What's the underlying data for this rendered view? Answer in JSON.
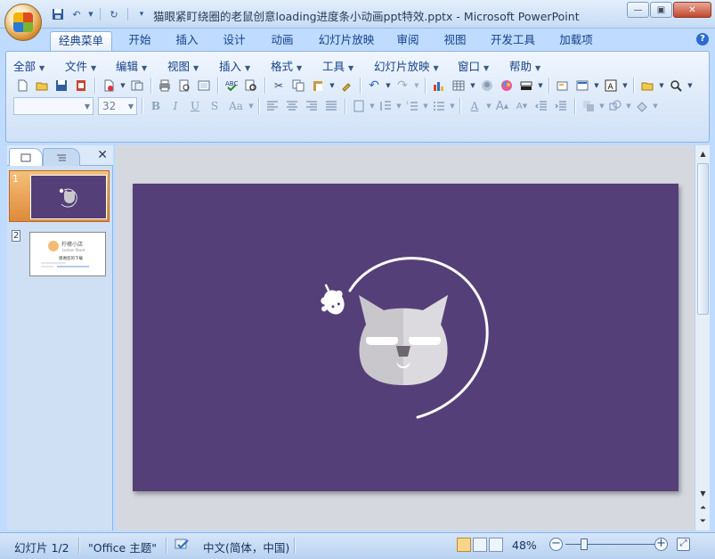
{
  "window": {
    "title": "猫眼紧盯绕圈的老鼠创意loading进度条小动画ppt特效.pptx - Microsoft PowerPoint",
    "controls": [
      "minimize",
      "maximize",
      "close"
    ]
  },
  "ribbon_tabs": [
    {
      "label": "经典菜单",
      "active": true
    },
    {
      "label": "开始"
    },
    {
      "label": "插入"
    },
    {
      "label": "设计"
    },
    {
      "label": "动画"
    },
    {
      "label": "幻灯片放映"
    },
    {
      "label": "审阅"
    },
    {
      "label": "视图"
    },
    {
      "label": "开发工具"
    },
    {
      "label": "加载项"
    }
  ],
  "menu_bar": [
    {
      "label": "全部"
    },
    {
      "label": "文件"
    },
    {
      "label": "编辑"
    },
    {
      "label": "视图"
    },
    {
      "label": "插入"
    },
    {
      "label": "格式"
    },
    {
      "label": "工具"
    },
    {
      "label": "幻灯片放映"
    },
    {
      "label": "窗口"
    },
    {
      "label": "帮助"
    }
  ],
  "font_box": {
    "font_name": "",
    "font_size": "32"
  },
  "format_buttons": {
    "bold": "B",
    "italic": "I",
    "underline": "U",
    "shadow": "S",
    "case": "Aa",
    "font_color": "A"
  },
  "slides": [
    {
      "number": "1",
      "selected": true
    },
    {
      "number": "2",
      "selected": false,
      "title": "柠檬小店",
      "subtitle": "Lemon Store",
      "heading": "感谢您的下载"
    }
  ],
  "status_bar": {
    "slide_counter": "幻灯片 1/2",
    "theme": "\"Office 主题\"",
    "language": "中文(简体，中国)",
    "zoom": "48%",
    "zoom_fraction": 0.48
  },
  "colors": {
    "slide_background": "#553f79",
    "cat_face": "#c9c7cc",
    "accent": "#f4bc73"
  }
}
